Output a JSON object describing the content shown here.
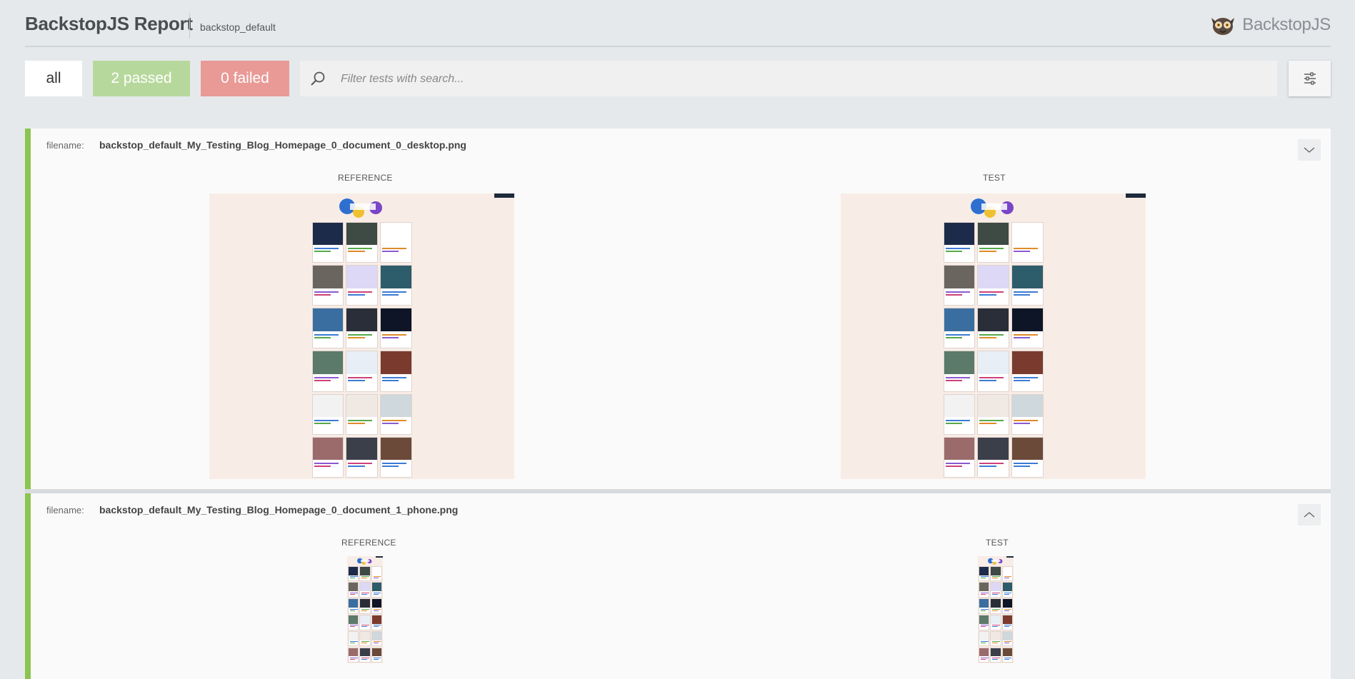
{
  "header": {
    "title": "BackstopJS Report",
    "subtitle": "backstop_default",
    "brand_name": "BackstopJS",
    "brand_icon": "lemur-logo-icon"
  },
  "toolbar": {
    "all_label": "all",
    "passed_label": "2 passed",
    "failed_label": "0 failed",
    "search_placeholder": "Filter tests with search...",
    "search_icon": "search-icon",
    "settings_icon": "settings-sliders-icon"
  },
  "colors": {
    "passed": "#b7d89c",
    "failed": "#e99a96",
    "pass_bar": "#8cc450",
    "background": "#e5e9ec"
  },
  "tests": [
    {
      "filename_label": "filename:",
      "filename": "backstop_default_My_Testing_Blog_Homepage_0_document_0_desktop.png",
      "reference_label": "REFERENCE",
      "test_label": "TEST",
      "toggle_icon": "chevron-down-icon",
      "status": "passed"
    },
    {
      "filename_label": "filename:",
      "filename": "backstop_default_My_Testing_Blog_Homepage_0_document_1_phone.png",
      "reference_label": "REFERENCE",
      "test_label": "TEST",
      "toggle_icon": "chevron-up-icon",
      "status": "passed"
    }
  ]
}
